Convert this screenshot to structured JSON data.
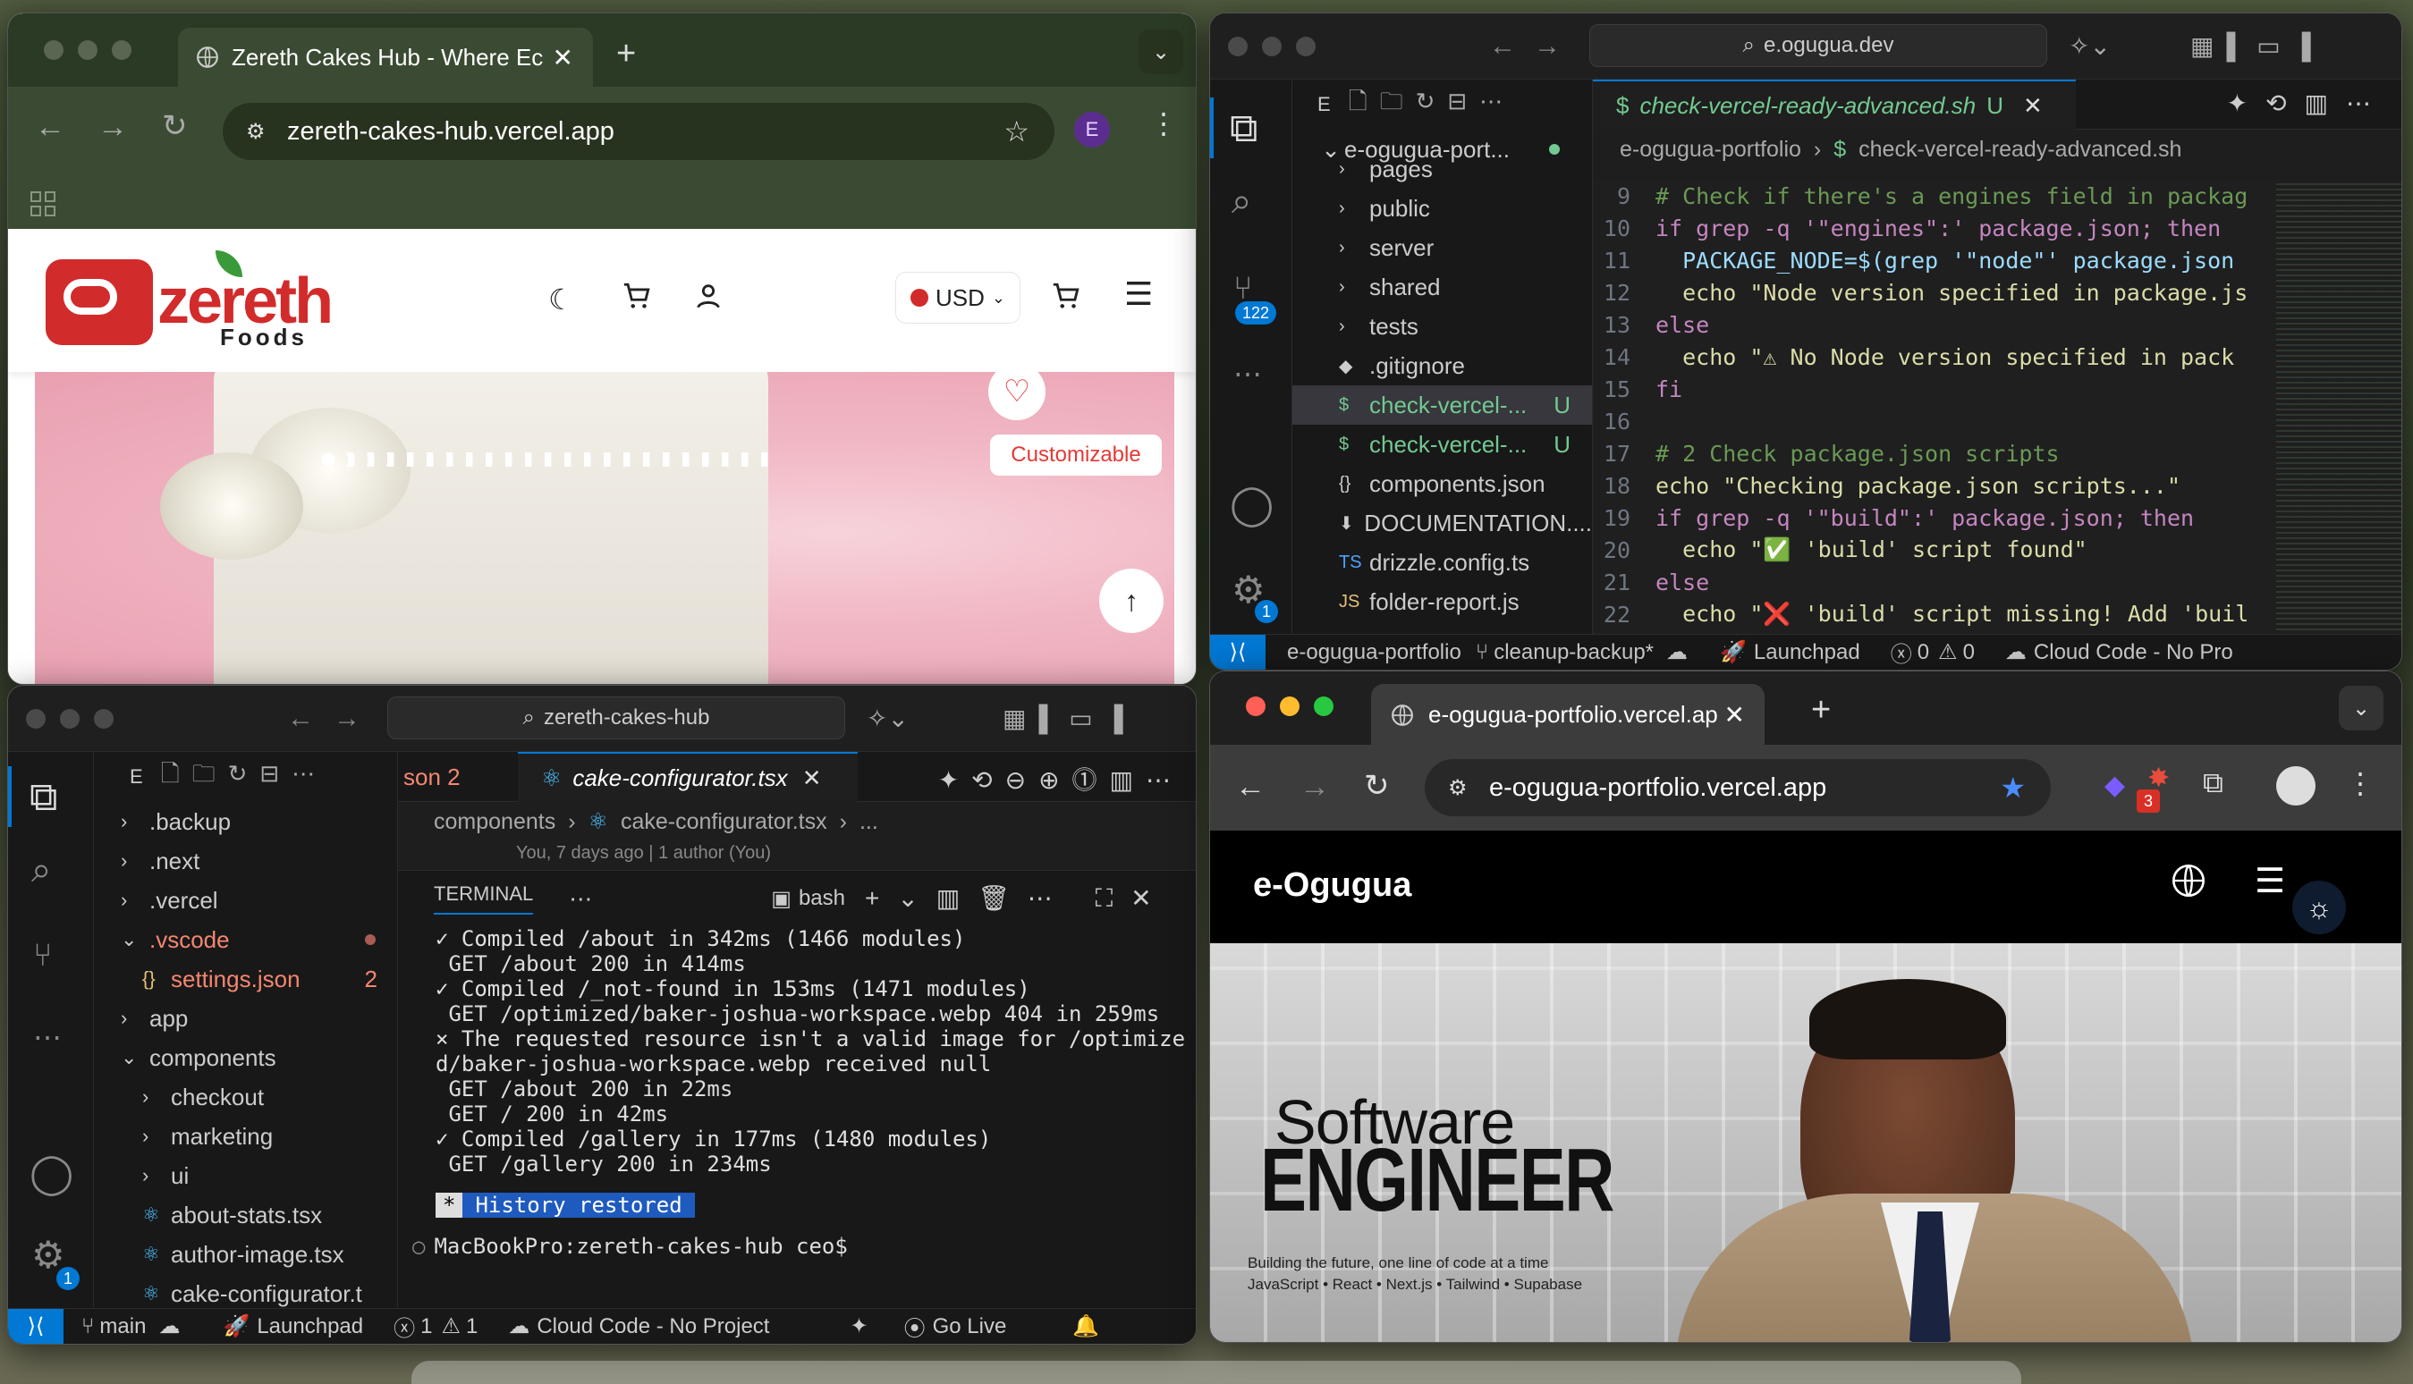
{
  "browser1": {
    "tab_title": "Zereth Cakes Hub - Where Ec",
    "url": "zereth-cakes-hub.vercel.app",
    "profile_initial": "E",
    "site": {
      "logo_name": "zereth",
      "logo_sub": "Foods",
      "currency": "USD",
      "badge": "Customizable"
    }
  },
  "vscode_top": {
    "search": "e.ogugua.dev",
    "tab_file": "check-vercel-ready-advanced.sh",
    "tab_status": "U",
    "explorer_label": "E",
    "repo": "e-ogugua-port...",
    "badge_scm": "122",
    "badge_settings": "1",
    "breadcrumb": [
      "e-ogugua-portfolio",
      "check-vercel-ready-advanced.sh"
    ],
    "tree": [
      {
        "label": "pages",
        "type": "folder"
      },
      {
        "label": "public",
        "type": "folder"
      },
      {
        "label": "server",
        "type": "folder"
      },
      {
        "label": "shared",
        "type": "folder"
      },
      {
        "label": "tests",
        "type": "folder"
      },
      {
        "label": ".gitignore",
        "type": "file",
        "icon": "◆"
      },
      {
        "label": "check-vercel-...",
        "type": "file",
        "icon": "$",
        "status": "U"
      },
      {
        "label": "check-vercel-...",
        "type": "file",
        "icon": "$",
        "status": "U"
      },
      {
        "label": "components.json",
        "type": "file",
        "icon": "{}"
      },
      {
        "label": "DOCUMENTATION....",
        "type": "file",
        "icon": "⬇"
      },
      {
        "label": "drizzle.config.ts",
        "type": "file",
        "icon": "TS"
      },
      {
        "label": "folder-report.js",
        "type": "file",
        "icon": "JS"
      }
    ],
    "code_lines": [
      {
        "n": "9",
        "text": "# Check if there's a engines field in packag"
      },
      {
        "n": "10",
        "text": "if grep -q '\"engines\":' package.json; then"
      },
      {
        "n": "11",
        "text": "  PACKAGE_NODE=$(grep '\"node\"' package.json"
      },
      {
        "n": "12",
        "text": "  echo \"Node version specified in package.js"
      },
      {
        "n": "13",
        "text": "else"
      },
      {
        "n": "14",
        "text": "  echo \"⚠ No Node version specified in pack"
      },
      {
        "n": "15",
        "text": "fi"
      },
      {
        "n": "16",
        "text": ""
      },
      {
        "n": "17",
        "text": "# 2 Check package.json scripts"
      },
      {
        "n": "18",
        "text": "echo \"Checking package.json scripts...\""
      },
      {
        "n": "19",
        "text": "if grep -q '\"build\":' package.json; then"
      },
      {
        "n": "20",
        "text": "  echo \"✅ 'build' script found\""
      },
      {
        "n": "21",
        "text": "else"
      },
      {
        "n": "22",
        "text": "  echo \"❌ 'build' script missing! Add 'buil"
      }
    ],
    "status": {
      "project": "e-ogugua-portfolio",
      "branch": "cleanup-backup*",
      "launchpad": "Launchpad",
      "errors": "0",
      "warnings": "0",
      "cloud": "Cloud Code - No Pro"
    }
  },
  "vscode_bottom": {
    "search": "zereth-cakes-hub",
    "tab_prev": "son 2",
    "tab_file": "cake-configurator.tsx",
    "explorer_label": "E",
    "badge_settings": "1",
    "breadcrumb": [
      "components",
      "cake-configurator.tsx",
      "..."
    ],
    "blame": "You, 7 days ago | 1 author (You)",
    "tree": [
      {
        "label": ".backup",
        "type": "folder",
        "indent": 0
      },
      {
        "label": ".next",
        "type": "folder",
        "indent": 0
      },
      {
        "label": ".vercel",
        "type": "folder",
        "indent": 0
      },
      {
        "label": ".vscode",
        "type": "folder-open",
        "indent": 0,
        "color": "#f48771"
      },
      {
        "label": "settings.json",
        "type": "file",
        "indent": 1,
        "icon": "{}",
        "color": "#f48771",
        "count": "2"
      },
      {
        "label": "app",
        "type": "folder",
        "indent": 0
      },
      {
        "label": "components",
        "type": "folder-open",
        "indent": 0
      },
      {
        "label": "checkout",
        "type": "folder",
        "indent": 1
      },
      {
        "label": "marketing",
        "type": "folder",
        "indent": 1
      },
      {
        "label": "ui",
        "type": "folder",
        "indent": 1
      },
      {
        "label": "about-stats.tsx",
        "type": "file",
        "indent": 1,
        "icon": "⚛"
      },
      {
        "label": "author-image.tsx",
        "type": "file",
        "indent": 1,
        "icon": "⚛"
      },
      {
        "label": "cake-configurator.t",
        "type": "file",
        "indent": 1,
        "icon": "⚛"
      }
    ],
    "terminal": {
      "panel_label": "TERMINAL",
      "shell": "bash",
      "lines": [
        {
          "text": "✓ Compiled /about in 342ms (1466 modules)"
        },
        {
          "text": " GET /about 200 in 414ms"
        },
        {
          "text": "✓ Compiled /_not-found in 153ms (1471 modules)"
        },
        {
          "text": " GET /optimized/baker-joshua-workspace.webp 404 in 259ms"
        },
        {
          "text": "⨯ The requested resource isn't a valid image for /optimize"
        },
        {
          "text": "d/baker-joshua-workspace.webp received null"
        },
        {
          "text": " GET /about 200 in 22ms"
        },
        {
          "text": " GET / 200 in 42ms"
        },
        {
          "text": "✓ Compiled /gallery in 177ms (1480 modules)"
        },
        {
          "text": " GET /gallery 200 in 234ms"
        }
      ],
      "history": "History restored",
      "prompt": "MacBookPro:zereth-cakes-hub ceo$"
    },
    "status": {
      "branch": "main",
      "launchpad": "Launchpad",
      "errors": "1",
      "warnings": "1",
      "cloud": "Cloud Code - No Project",
      "golive": "Go Live"
    }
  },
  "browser2": {
    "tab_title": "e-ogugua-portfolio.vercel.ap",
    "url": "e-ogugua-portfolio.vercel.app",
    "ext_badge": "3",
    "site": {
      "brand": "e-Ogugua",
      "hero_line1": "Software",
      "hero_line2": "ENGINEER",
      "tagline": "Building the future, one line of code at a time",
      "stack": "JavaScript • React • Next.js • Tailwind • Supabase"
    }
  }
}
